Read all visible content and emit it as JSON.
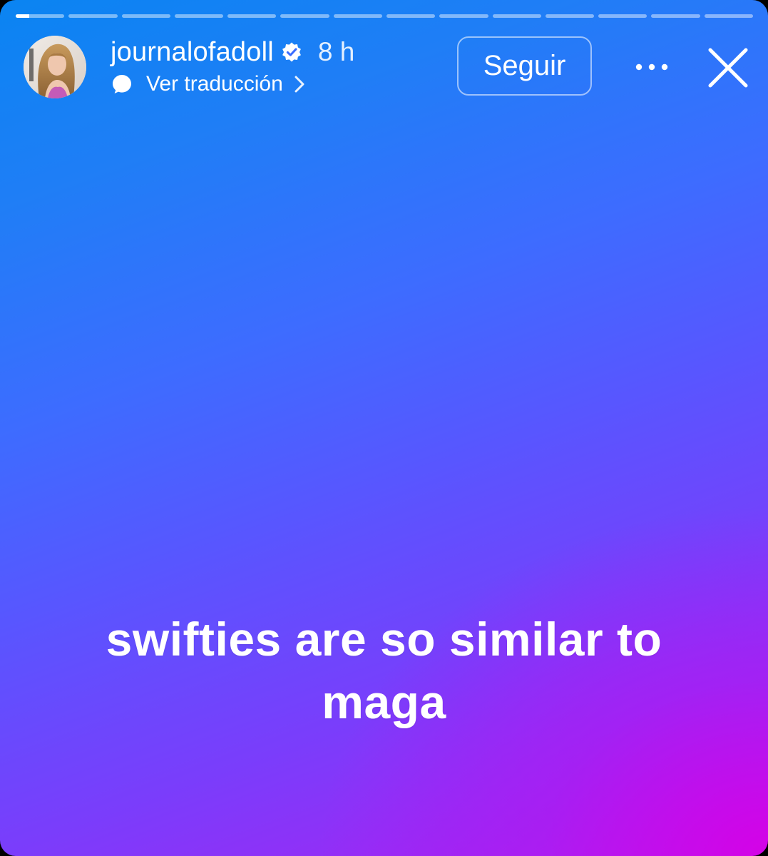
{
  "story": {
    "segment_count": 14,
    "active_segment": 0,
    "active_progress": 0.28,
    "colors": {
      "gradient_start": "#0a84f2",
      "gradient_mid": "#5856ff",
      "gradient_end": "#d600e6"
    }
  },
  "header": {
    "username": "journalofadoll",
    "verified": true,
    "time_ago": "8 h",
    "translate_label": "Ver traducción",
    "follow_label": "Seguir",
    "icons": {
      "verified": "verified-badge-icon",
      "translate": "speech-bubble-icon",
      "chevron": "chevron-right-icon",
      "more": "more-horizontal-icon",
      "close": "close-icon"
    }
  },
  "caption": {
    "text": "swifties are so similar to maga"
  }
}
